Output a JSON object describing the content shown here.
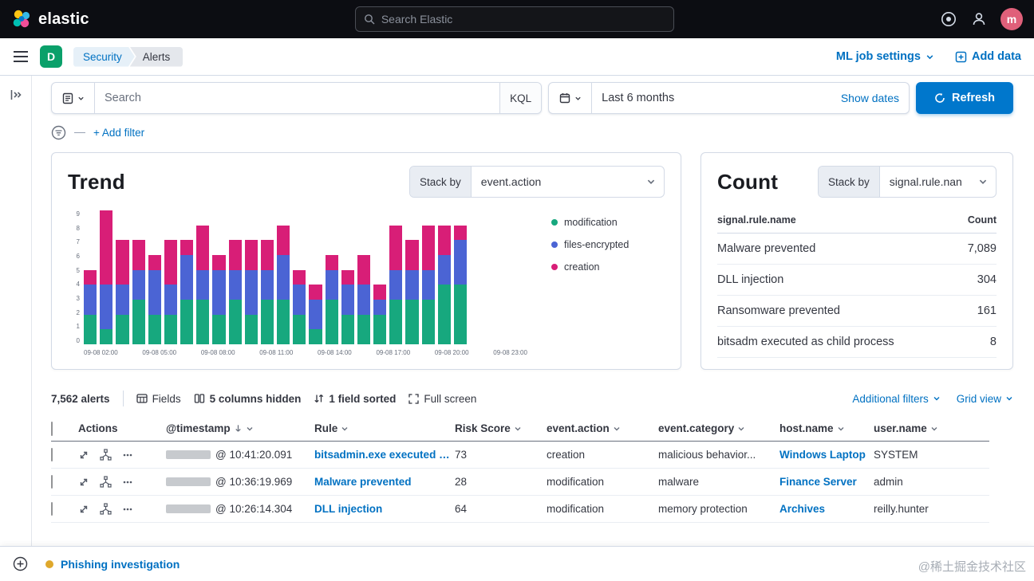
{
  "header": {
    "logo_text": "elastic",
    "search_placeholder": "Search Elastic",
    "avatar_initial": "m"
  },
  "nav": {
    "space_initial": "D",
    "breadcrumbs": [
      "Security",
      "Alerts"
    ],
    "ml_job_settings": "ML job settings",
    "add_data": "Add data"
  },
  "query_bar": {
    "search_placeholder": "Search",
    "kql_label": "KQL",
    "date_range": "Last 6 months",
    "show_dates_label": "Show dates",
    "refresh_label": "Refresh",
    "add_filter_label": "+ Add filter"
  },
  "trend": {
    "title": "Trend",
    "stack_by_label": "Stack by",
    "stack_by_value": "event.action",
    "chart_data": {
      "type": "bar",
      "stacked": true,
      "title": "Trend",
      "xlabel": "",
      "ylabel": "",
      "ylim": [
        0,
        9
      ],
      "y_ticks": [
        0,
        1,
        2,
        3,
        4,
        5,
        6,
        7,
        8,
        9
      ],
      "x_tick_labels": [
        "09-08 02:00",
        "09-08 05:00",
        "09-08 08:00",
        "09-08 11:00",
        "09-08 14:00",
        "09-08 17:00",
        "09-08 20:00",
        "09-08 23:00"
      ],
      "legend_position": "right",
      "series": [
        {
          "name": "modification",
          "color": "#17a87e",
          "values": [
            2,
            1,
            2,
            3,
            2,
            2,
            3,
            3,
            2,
            3,
            2,
            3,
            3,
            2,
            1,
            3,
            2,
            2,
            2,
            3,
            3,
            3,
            4,
            4
          ]
        },
        {
          "name": "files-encrypted",
          "color": "#4b64d4",
          "values": [
            2,
            3,
            2,
            2,
            3,
            2,
            3,
            2,
            3,
            2,
            3,
            2,
            3,
            2,
            2,
            2,
            2,
            2,
            1,
            2,
            2,
            2,
            2,
            3
          ]
        },
        {
          "name": "creation",
          "color": "#d81e77",
          "values": [
            1,
            5,
            3,
            2,
            1,
            3,
            1,
            3,
            1,
            2,
            2,
            2,
            2,
            1,
            1,
            1,
            1,
            2,
            1,
            3,
            2,
            3,
            2,
            1
          ]
        }
      ]
    }
  },
  "count": {
    "title": "Count",
    "stack_by_label": "Stack by",
    "stack_by_value": "signal.rule.nan",
    "chart_data": {
      "type": "table",
      "columns": [
        "signal.rule.name",
        "Count"
      ],
      "rows": [
        [
          "Malware prevented",
          "7,089"
        ],
        [
          "DLL injection",
          "304"
        ],
        [
          "Ransomware prevented",
          "161"
        ],
        [
          "bitsadm executed as child process",
          "8"
        ]
      ]
    }
  },
  "alerts": {
    "count_label": "7,562 alerts",
    "toolbar": {
      "fields": "Fields",
      "columns_hidden": "5 columns hidden",
      "field_sorted": "1 field sorted",
      "full_screen": "Full screen",
      "additional_filters": "Additional filters",
      "grid_view": "Grid view"
    },
    "columns": [
      "Actions",
      "@timestamp",
      "Rule",
      "Risk Score",
      "event.action",
      "event.category",
      "host.name",
      "user.name"
    ],
    "rows": [
      {
        "timestamp": "@ 10:41:20.091",
        "rule": "bitsadmin.exe executed as ...",
        "risk_score": "73",
        "event_action": "creation",
        "event_category": "malicious behavior...",
        "host_name": "Windows Laptop",
        "user_name": "SYSTEM"
      },
      {
        "timestamp": "@ 10:36:19.969",
        "rule": "Malware prevented",
        "risk_score": "28",
        "event_action": "modification",
        "event_category": "malware",
        "host_name": "Finance Server",
        "user_name": "admin"
      },
      {
        "timestamp": "@ 10:26:14.304",
        "rule": "DLL injection",
        "risk_score": "64",
        "event_action": "modification",
        "event_category": "memory protection",
        "host_name": "Archives",
        "user_name": "reilly.hunter"
      }
    ]
  },
  "timeline_bar": {
    "name": "Phishing investigation"
  },
  "watermark": "@稀土掘金技术社区",
  "colors": {
    "accent_blue": "#0077cc",
    "link_blue": "#0071c2",
    "badge_green": "#0aa06a",
    "avatar_pink": "#e0607a",
    "timeline_dot_yellow": "#dfa82c",
    "series_modification": "#17a87e",
    "series_files_encrypted": "#4b64d4",
    "series_creation": "#d81e77"
  }
}
